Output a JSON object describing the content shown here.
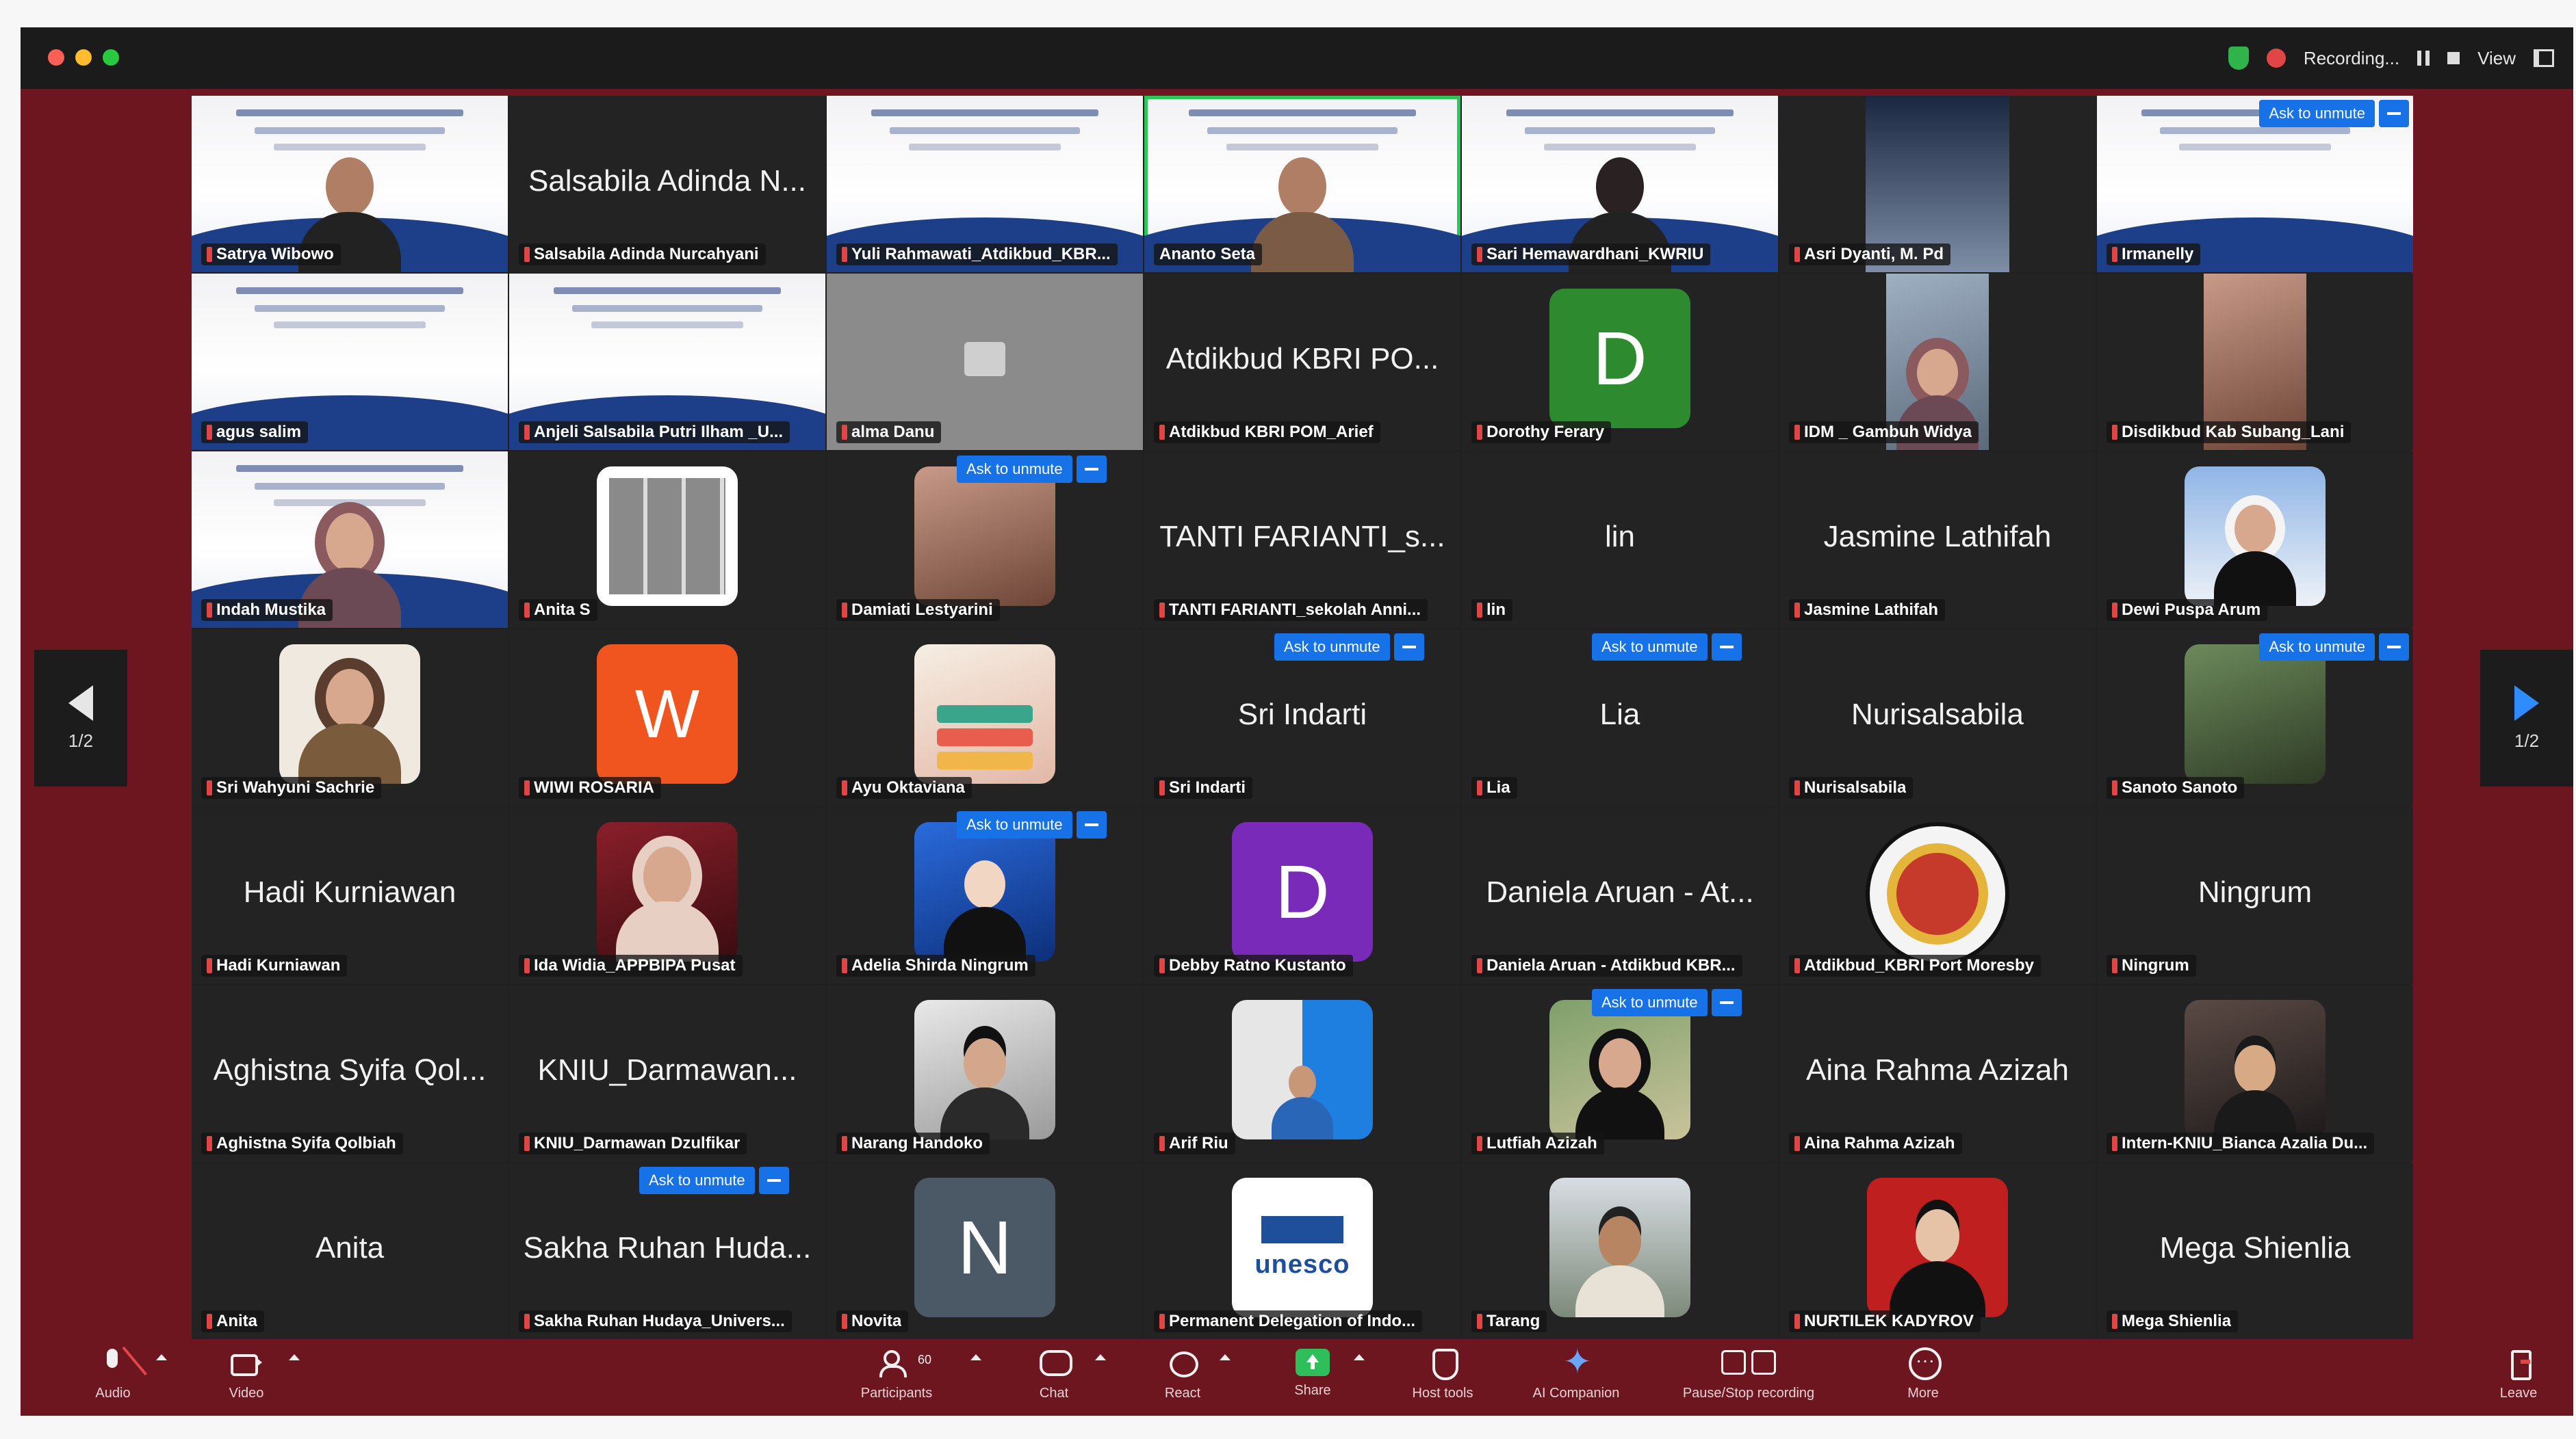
{
  "topbar": {
    "recording_label": "Recording...",
    "view_label": "View",
    "colors": {
      "close": "#ff5f57",
      "minimize": "#febc2e",
      "zoom": "#28c840"
    }
  },
  "pagination": {
    "left": "1/2",
    "right": "1/2"
  },
  "unmute_label": "Ask to unmute",
  "tiles": [
    {
      "name": "Satrya Wibowo"
    },
    {
      "big": "Salsabila Adinda N...",
      "name": "Salsabila Adinda Nurcahyani"
    },
    {
      "name": "Yuli Rahmawati_Atdikbud_KBR..."
    },
    {
      "name": "Ananto Seta"
    },
    {
      "name": "Sari Hemawardhani_KWRIU"
    },
    {
      "name": "Asri Dyanti, M. Pd"
    },
    {
      "name": "Irmanelly"
    },
    {
      "name": "agus salim"
    },
    {
      "name": "Anjeli Salsabila Putri Ilham _U..."
    },
    {
      "name": "alma Danu"
    },
    {
      "big": "Atdikbud KBRI PO...",
      "name": "Atdikbud KBRI POM_Arief"
    },
    {
      "letter": "D",
      "name": "Dorothy Ferary"
    },
    {
      "name": "IDM _ Gambuh Widya"
    },
    {
      "name": "Disdikbud Kab Subang_Lani"
    },
    {
      "name": "Indah Mustika"
    },
    {
      "name": "Anita S"
    },
    {
      "name": "Damiati Lestyarini"
    },
    {
      "big": "TANTI FARIANTI_s...",
      "name": "TANTI FARIANTI_sekolah Anni..."
    },
    {
      "big": "lin",
      "name": "lin"
    },
    {
      "big": "Jasmine Lathifah",
      "name": "Jasmine Lathifah"
    },
    {
      "name": "Dewi Puspa Arum"
    },
    {
      "name": "Sri Wahyuni Sachrie"
    },
    {
      "letter": "W",
      "name": "WIWI ROSARIA"
    },
    {
      "name": "Ayu Oktaviana"
    },
    {
      "big": "Sri Indarti",
      "name": "Sri Indarti"
    },
    {
      "big": "Lia",
      "name": "Lia"
    },
    {
      "big": "Nurisalsabila",
      "name": "Nurisalsabila"
    },
    {
      "name": "Sanoto Sanoto"
    },
    {
      "big": "Hadi Kurniawan",
      "name": "Hadi Kurniawan"
    },
    {
      "name": "Ida Widia_APPBIPA Pusat"
    },
    {
      "name": "Adelia Shirda Ningrum"
    },
    {
      "letter": "D",
      "name": "Debby Ratno Kustanto"
    },
    {
      "big": "Daniela Aruan - At...",
      "name": "Daniela Aruan - Atdikbud KBR..."
    },
    {
      "name": "Atdikbud_KBRI Port Moresby"
    },
    {
      "big": "Ningrum",
      "name": "Ningrum"
    },
    {
      "big": "Aghistna Syifa Qol...",
      "name": "Aghistna Syifa Qolbiah"
    },
    {
      "big": "KNIU_Darmawan...",
      "name": "KNIU_Darmawan Dzulfikar"
    },
    {
      "name": "Narang Handoko"
    },
    {
      "name": "Arif Riu"
    },
    {
      "name": "Lutfiah Azizah"
    },
    {
      "big": "Aina Rahma Azizah",
      "name": "Aina Rahma Azizah"
    },
    {
      "name": "Intern-KNIU_Bianca Azalia Du..."
    },
    {
      "big": "Anita",
      "name": "Anita"
    },
    {
      "big": "Sakha Ruhan Huda...",
      "name": "Sakha Ruhan Hudaya_Univers..."
    },
    {
      "letter": "N",
      "name": "Novita"
    },
    {
      "logo_text": "unesco",
      "name": "Permanent Delegation of Indo..."
    },
    {
      "name": "Tarang"
    },
    {
      "name": "NURTILEK KADYROV"
    },
    {
      "big": "Mega Shienlia",
      "name": "Mega Shienlia"
    }
  ],
  "toolbar": {
    "audio": "Audio",
    "video": "Video",
    "participants": "Participants",
    "participants_count": "60",
    "chat": "Chat",
    "react": "React",
    "share": "Share",
    "host_tools": "Host tools",
    "ai_companion": "AI Companion",
    "pause_stop": "Pause/Stop recording",
    "more": "More",
    "leave": "Leave",
    "colors": {
      "share": "#2fbf5a",
      "muted": "#e04646",
      "unmute_button": "#1672e6"
    }
  }
}
